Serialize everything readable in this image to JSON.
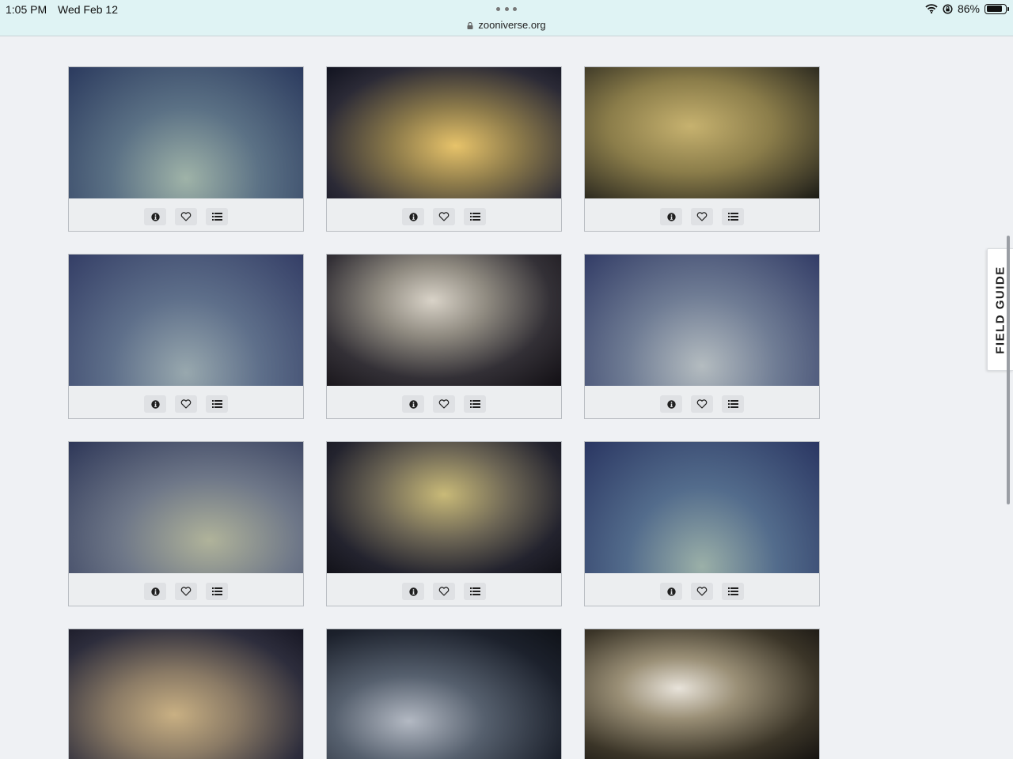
{
  "status_bar": {
    "time": "1:05 PM",
    "date": "Wed Feb 12",
    "url": "zooniverse.org",
    "battery": "86%",
    "battery_level": 0.86
  },
  "field_guide": {
    "label": "FIELD GUIDE"
  },
  "grid": {
    "card_count": 12,
    "card_actions": [
      "info-icon",
      "heart-icon",
      "collections-icon"
    ],
    "cards": [
      {
        "image": "Seafloor with soft corals"
      },
      {
        "image": "Robotic arm near orange coral"
      },
      {
        "image": "Sponge-covered rock"
      },
      {
        "image": "Seafloor with whip corals"
      },
      {
        "image": "Robotic arm in white coral"
      },
      {
        "image": "Whip corals on seafloor"
      },
      {
        "image": "Sediment-covered seafloor"
      },
      {
        "image": "Robotic arm on rock"
      },
      {
        "image": "Seafloor with sea fans"
      },
      {
        "image": "Rock with orange coral"
      },
      {
        "image": "Sample box with robotic arm"
      },
      {
        "image": "Sea fan and robotic arm"
      }
    ]
  },
  "colors": {
    "page_background": "#eff1f4",
    "status_bar_background": "#dff3f4",
    "card_border": "#b9bdc2",
    "action_button": "#dfe1e4"
  }
}
